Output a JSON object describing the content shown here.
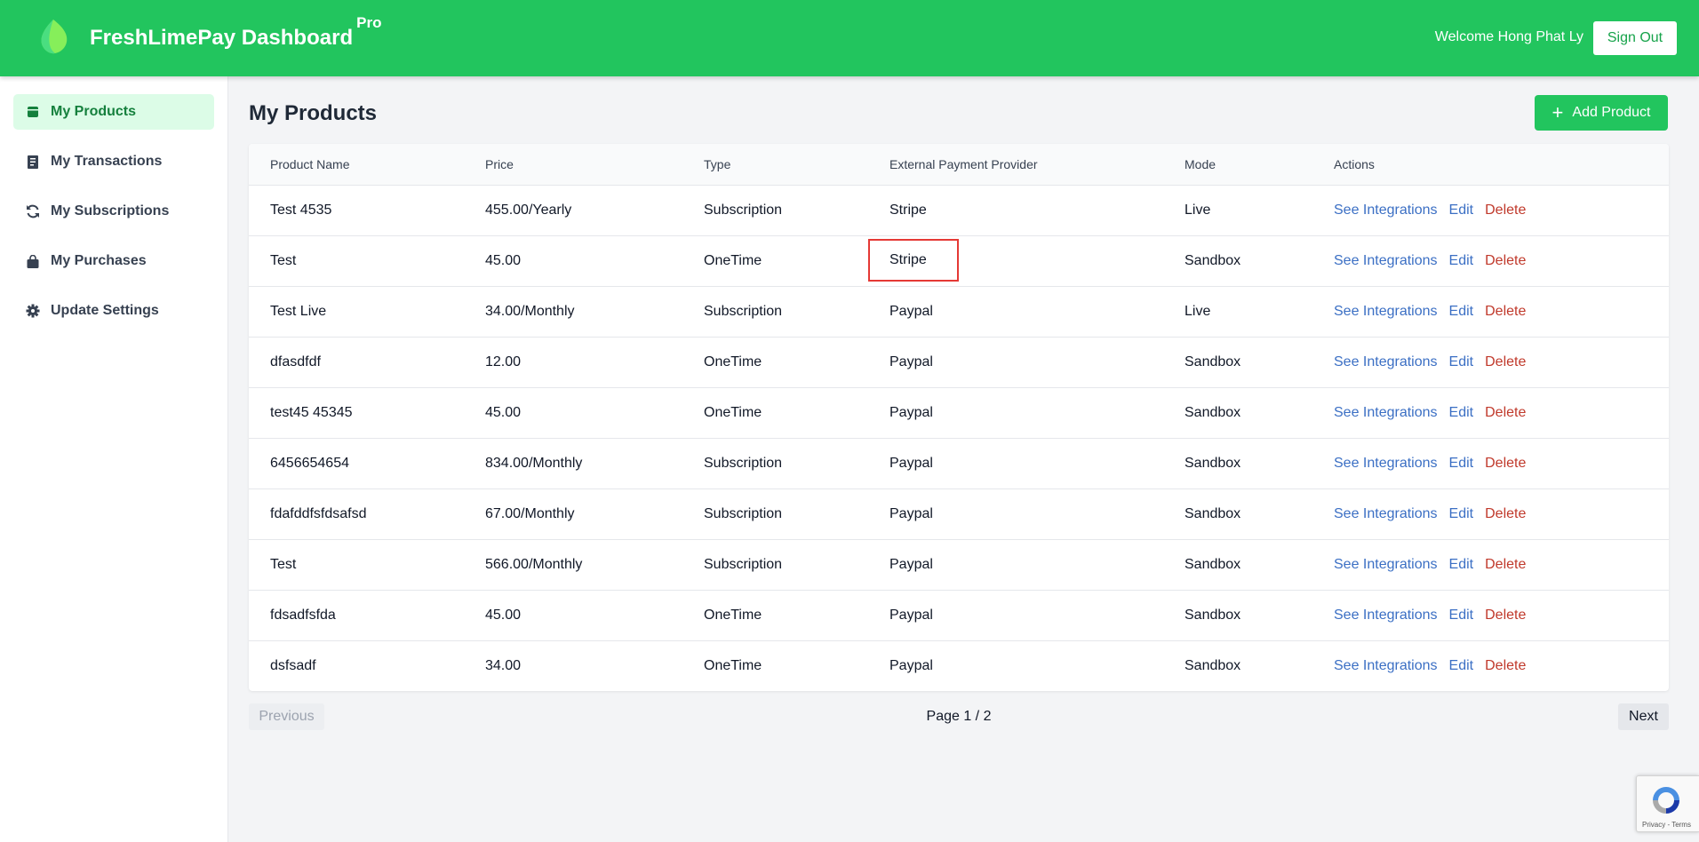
{
  "header": {
    "brand": "FreshLimePay Dashboard",
    "brand_badge": "Pro",
    "welcome": "Welcome Hong Phat Ly",
    "signout_label": "Sign Out"
  },
  "sidebar": {
    "items": [
      {
        "label": "My Products",
        "icon": "box-icon",
        "active": true
      },
      {
        "label": "My Transactions",
        "icon": "receipt-icon"
      },
      {
        "label": "My Subscriptions",
        "icon": "refresh-icon"
      },
      {
        "label": "My Purchases",
        "icon": "shopping-bag-icon"
      },
      {
        "label": "Update Settings",
        "icon": "gear-icon"
      }
    ]
  },
  "main": {
    "title": "My Products",
    "add_label": "Add Product",
    "columns": [
      "Product Name",
      "Price",
      "Type",
      "External Payment Provider",
      "Mode",
      "Actions"
    ],
    "rows": [
      {
        "name": "Test 4535",
        "price": "455.00/Yearly",
        "type": "Subscription",
        "provider": "Stripe",
        "mode": "Live"
      },
      {
        "name": "Test",
        "price": "45.00",
        "type": "OneTime",
        "provider": "Stripe",
        "mode": "Sandbox",
        "highlighted": true
      },
      {
        "name": "Test Live",
        "price": "34.00/Monthly",
        "type": "Subscription",
        "provider": "Paypal",
        "mode": "Live"
      },
      {
        "name": "dfasdfdf",
        "price": "12.00",
        "type": "OneTime",
        "provider": "Paypal",
        "mode": "Sandbox"
      },
      {
        "name": "test45 45345",
        "price": "45.00",
        "type": "OneTime",
        "provider": "Paypal",
        "mode": "Sandbox"
      },
      {
        "name": "6456654654",
        "price": "834.00/Monthly",
        "type": "Subscription",
        "provider": "Paypal",
        "mode": "Sandbox"
      },
      {
        "name": "fdafddfsfdsafsd",
        "price": "67.00/Monthly",
        "type": "Subscription",
        "provider": "Paypal",
        "mode": "Sandbox"
      },
      {
        "name": "Test",
        "price": "566.00/Monthly",
        "type": "Subscription",
        "provider": "Paypal",
        "mode": "Sandbox"
      },
      {
        "name": "fdsadfsfda",
        "price": "45.00",
        "type": "OneTime",
        "provider": "Paypal",
        "mode": "Sandbox"
      },
      {
        "name": "dsfsadf",
        "price": "34.00",
        "type": "OneTime",
        "provider": "Paypal",
        "mode": "Sandbox"
      }
    ],
    "actions": {
      "integrations": "See Integrations",
      "edit": "Edit",
      "delete": "Delete"
    },
    "pagination": {
      "prev": "Previous",
      "info": "Page 1 / 2",
      "next": "Next"
    }
  },
  "recaptcha": {
    "text": "Privacy - Terms"
  },
  "colors": {
    "brand": "#22c55e",
    "link": "#3b6fc4",
    "danger": "#c0392b",
    "highlight": "#e53935"
  }
}
